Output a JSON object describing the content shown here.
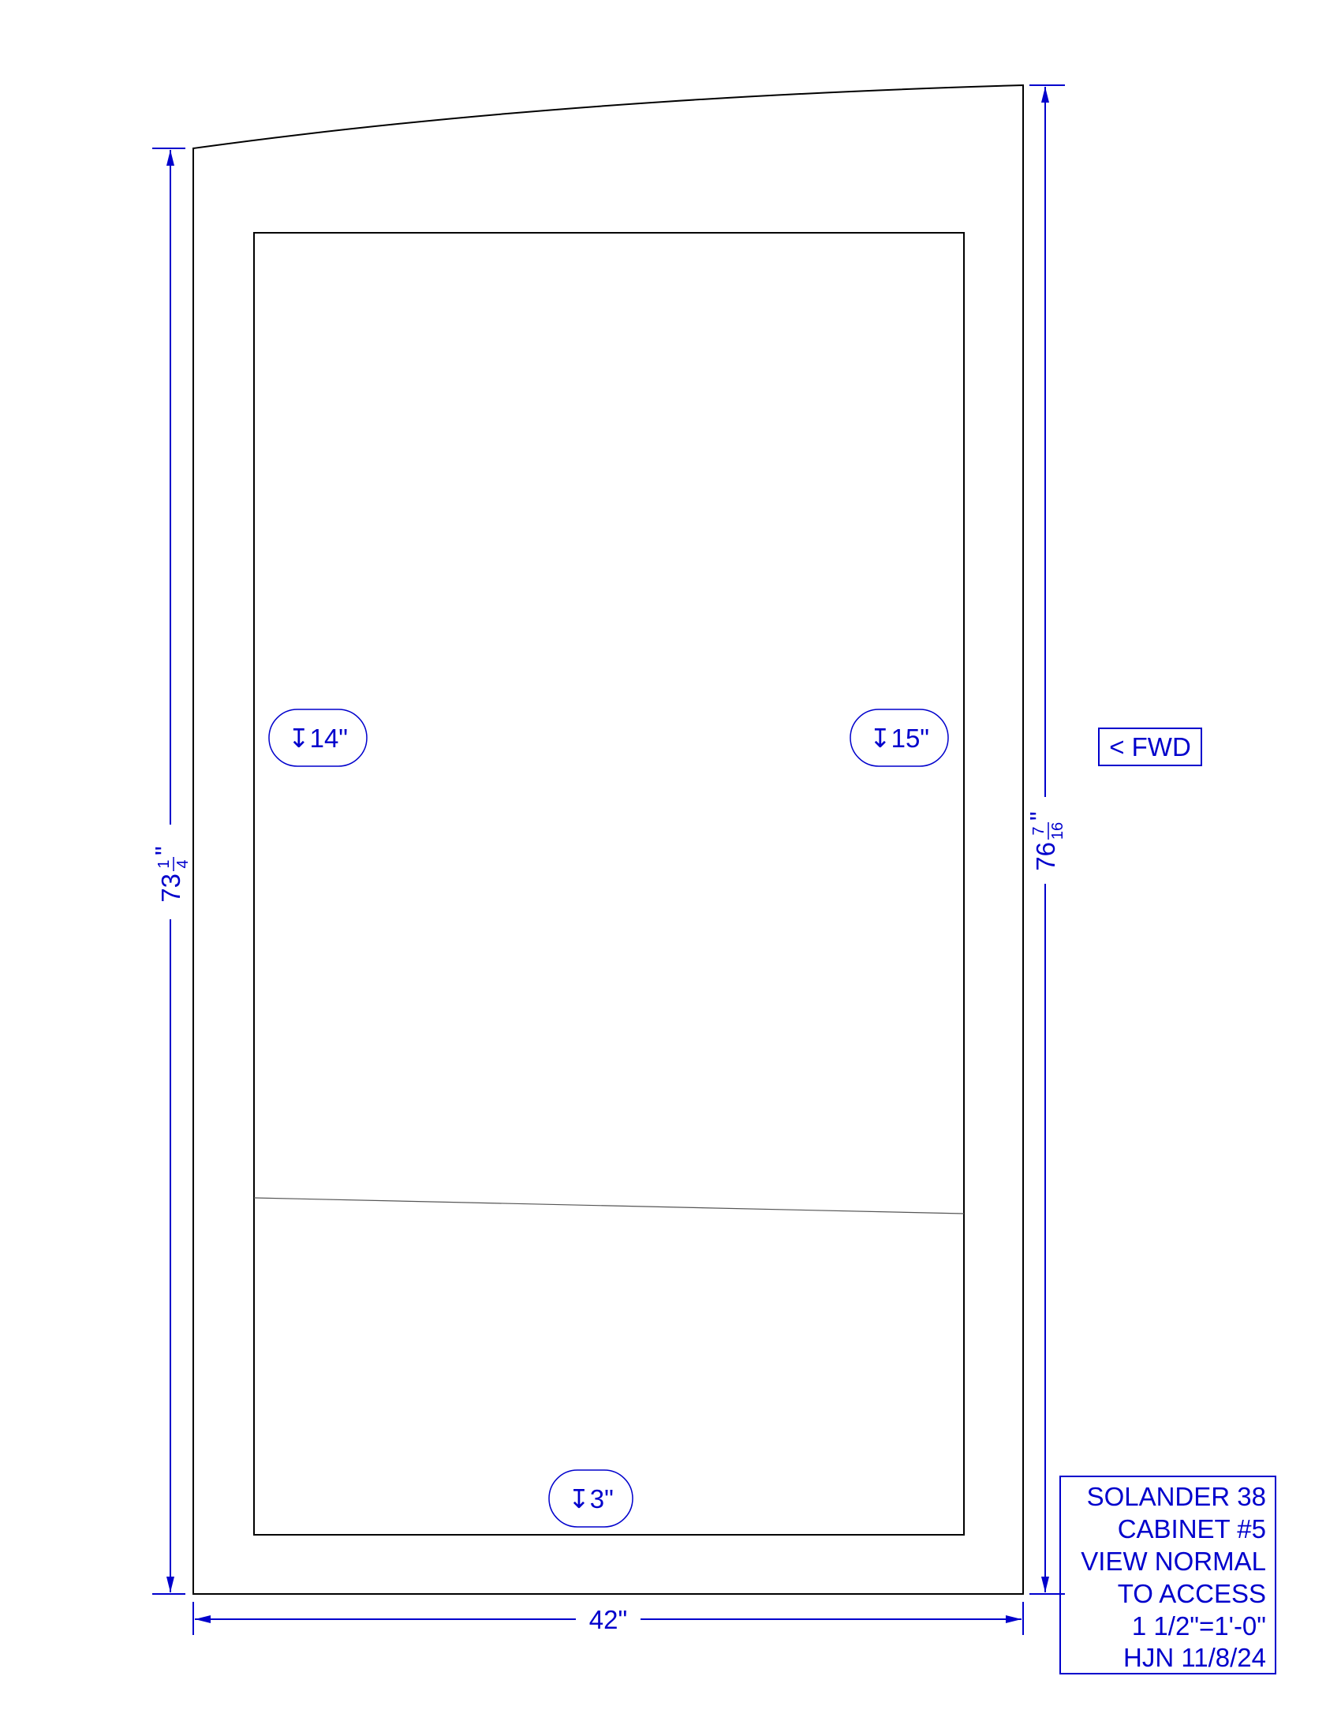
{
  "panel": {
    "left_height": "73",
    "left_height_num": "1",
    "left_height_den": "4",
    "right_height": "76",
    "right_height_num": "7",
    "right_height_den": "16",
    "width": "42\"",
    "inch_mark": "\""
  },
  "tags": {
    "left": "↧14\"",
    "right": "↧15\"",
    "bottom": "↧3\""
  },
  "direction": "< FWD",
  "title_block": {
    "lines": [
      "SOLANDER 38",
      "CABINET #5",
      "VIEW NORMAL",
      "TO ACCESS",
      "1 1/2\"=1'-0\"",
      "HJN 11/8/24"
    ]
  },
  "colors": {
    "dimension": "#0000cc",
    "outline": "#000000"
  }
}
